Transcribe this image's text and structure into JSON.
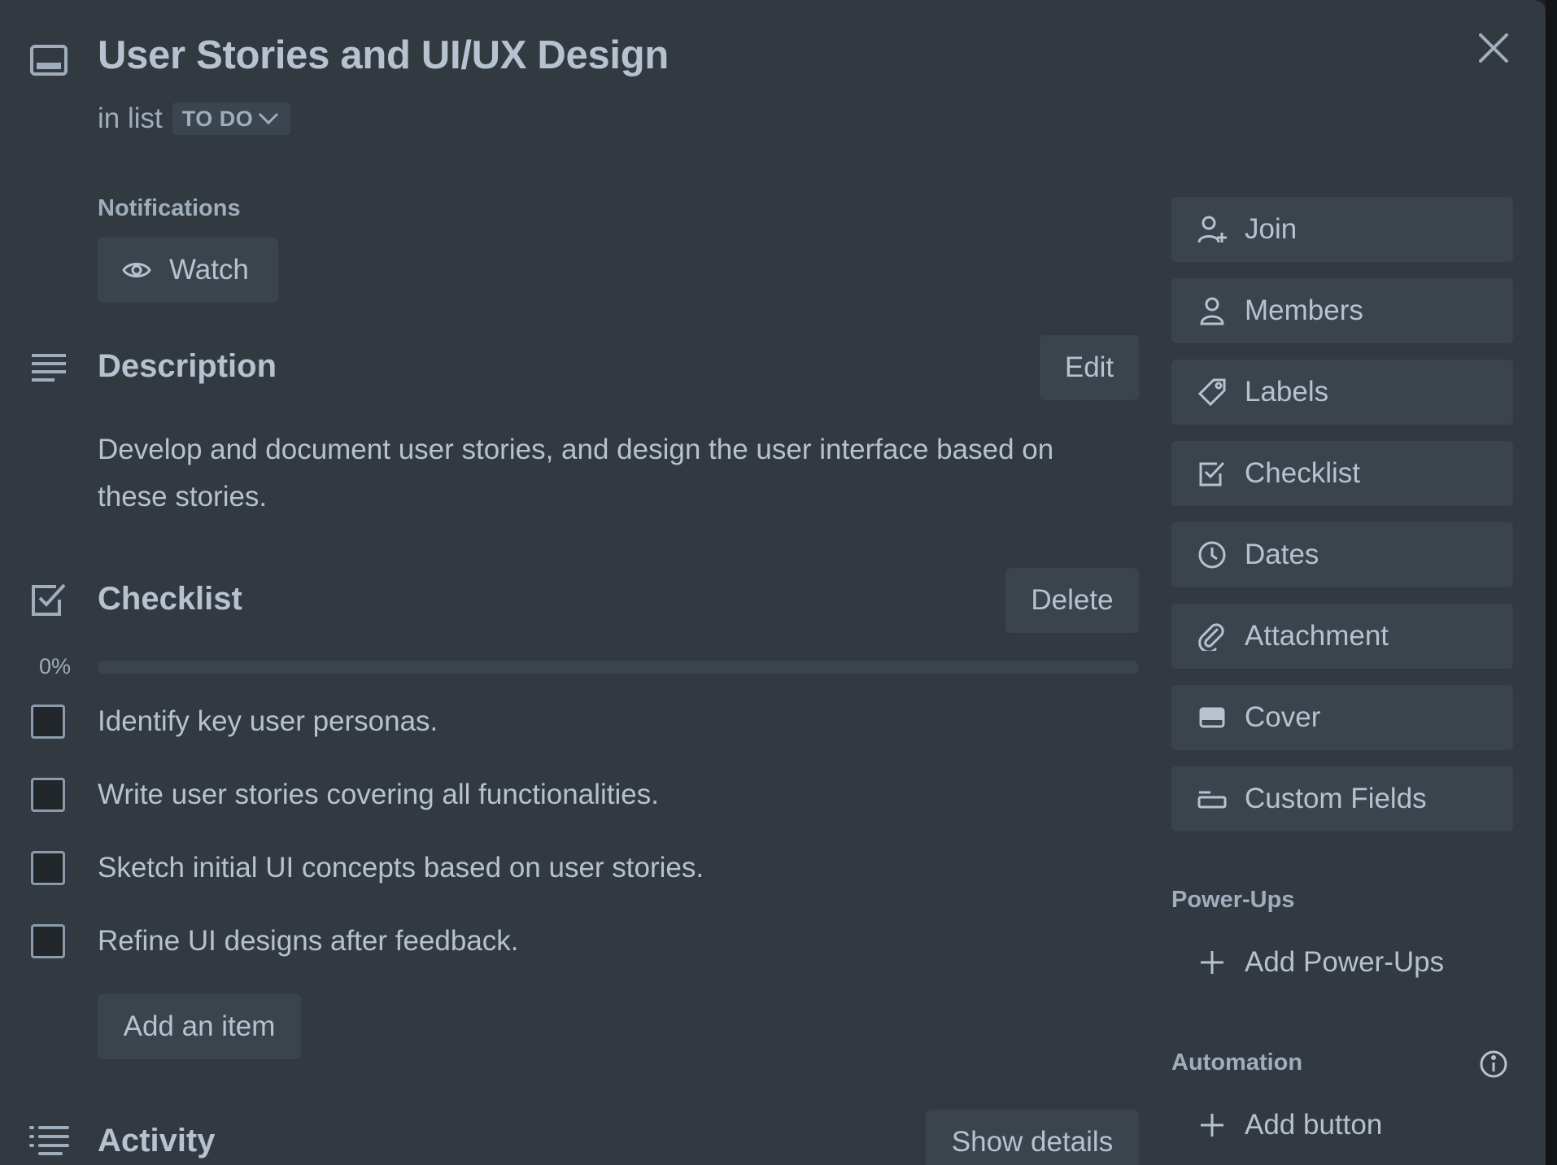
{
  "card": {
    "title": "User Stories and UI/UX Design",
    "in_list_prefix": "in list",
    "list_name": "TO DO"
  },
  "notifications": {
    "label": "Notifications",
    "watch_label": "Watch"
  },
  "description": {
    "title": "Description",
    "edit_label": "Edit",
    "text": "Develop and document user stories, and design the user interface based on these stories."
  },
  "checklist": {
    "title": "Checklist",
    "delete_label": "Delete",
    "progress_text": "0%",
    "progress": 0,
    "items": [
      {
        "text": "Identify key user personas.",
        "checked": false
      },
      {
        "text": "Write user stories covering all functionalities.",
        "checked": false
      },
      {
        "text": "Sketch initial UI concepts based on user stories.",
        "checked": false
      },
      {
        "text": "Refine UI designs after feedback.",
        "checked": false
      }
    ],
    "add_item_label": "Add an item"
  },
  "activity": {
    "title": "Activity",
    "show_details_label": "Show details"
  },
  "sidebar": {
    "actions": [
      {
        "label": "Join",
        "icon": "person-add-icon"
      },
      {
        "label": "Members",
        "icon": "person-icon"
      },
      {
        "label": "Labels",
        "icon": "tag-icon"
      },
      {
        "label": "Checklist",
        "icon": "checkbox-icon"
      },
      {
        "label": "Dates",
        "icon": "clock-icon"
      },
      {
        "label": "Attachment",
        "icon": "paperclip-icon"
      },
      {
        "label": "Cover",
        "icon": "cover-icon"
      },
      {
        "label": "Custom Fields",
        "icon": "custom-fields-icon"
      }
    ],
    "power_ups": {
      "label": "Power-Ups",
      "add_label": "Add Power-Ups"
    },
    "automation": {
      "label": "Automation",
      "add_label": "Add button"
    }
  },
  "colors": {
    "modal_bg": "#323940",
    "button_bg": "#3b444c",
    "text": "#b6c2cf",
    "subtle_text": "#9fadbc"
  }
}
